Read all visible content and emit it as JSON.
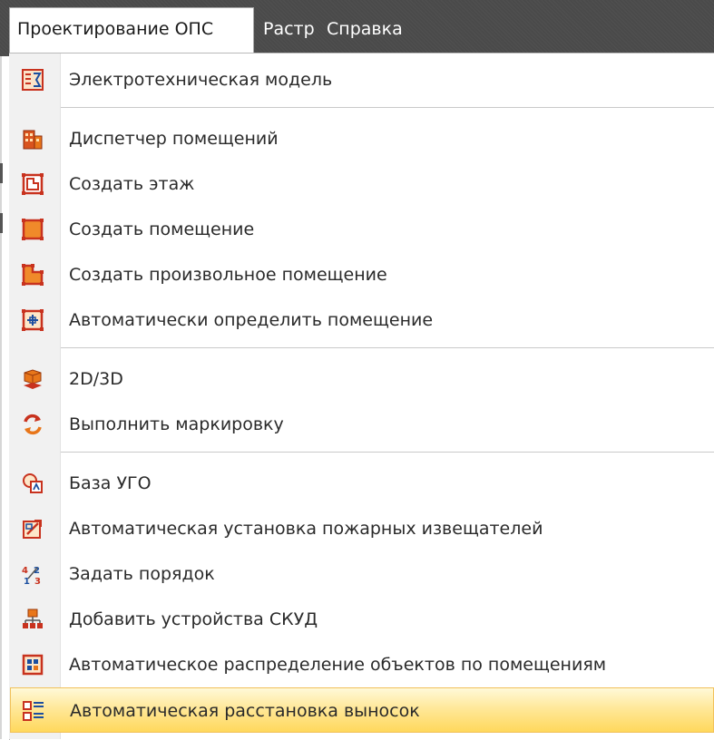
{
  "menubar": {
    "items": [
      {
        "label": "Проектирование ОПС",
        "active": true
      },
      {
        "label": "Растр",
        "active": false
      },
      {
        "label": "Справка",
        "active": false
      }
    ]
  },
  "menu": {
    "items": [
      {
        "label": "Электротехническая модель",
        "icon": "electrical-model-icon"
      },
      {
        "label": "Диспетчер помещений",
        "icon": "building-icon"
      },
      {
        "label": "Создать этаж",
        "icon": "create-floor-icon"
      },
      {
        "label": "Создать помещение",
        "icon": "create-room-icon"
      },
      {
        "label": "Создать произвольное помещение",
        "icon": "create-custom-room-icon"
      },
      {
        "label": "Автоматически определить помещение",
        "icon": "detect-room-icon"
      },
      {
        "label": "2D/3D",
        "icon": "view-2d3d-icon"
      },
      {
        "label": "Выполнить маркировку",
        "icon": "marking-icon"
      },
      {
        "label": "База УГО",
        "icon": "symbol-database-icon"
      },
      {
        "label": "Автоматическая установка пожарных извещателей",
        "icon": "fire-detector-placement-icon"
      },
      {
        "label": "Задать порядок",
        "icon": "order-numbering-icon"
      },
      {
        "label": "Добавить устройства СКУД",
        "icon": "access-control-icon"
      },
      {
        "label": "Автоматическое распределение объектов по помещениям",
        "icon": "object-distribution-icon"
      },
      {
        "label": "Автоматическая расстановка выносок",
        "icon": "callout-placement-icon",
        "highlighted": true
      }
    ]
  },
  "colors": {
    "menubar_bg": "#4a4a4a",
    "icon_red": "#c8321e",
    "icon_orange": "#e8761a",
    "highlight": "#ffd85c"
  }
}
